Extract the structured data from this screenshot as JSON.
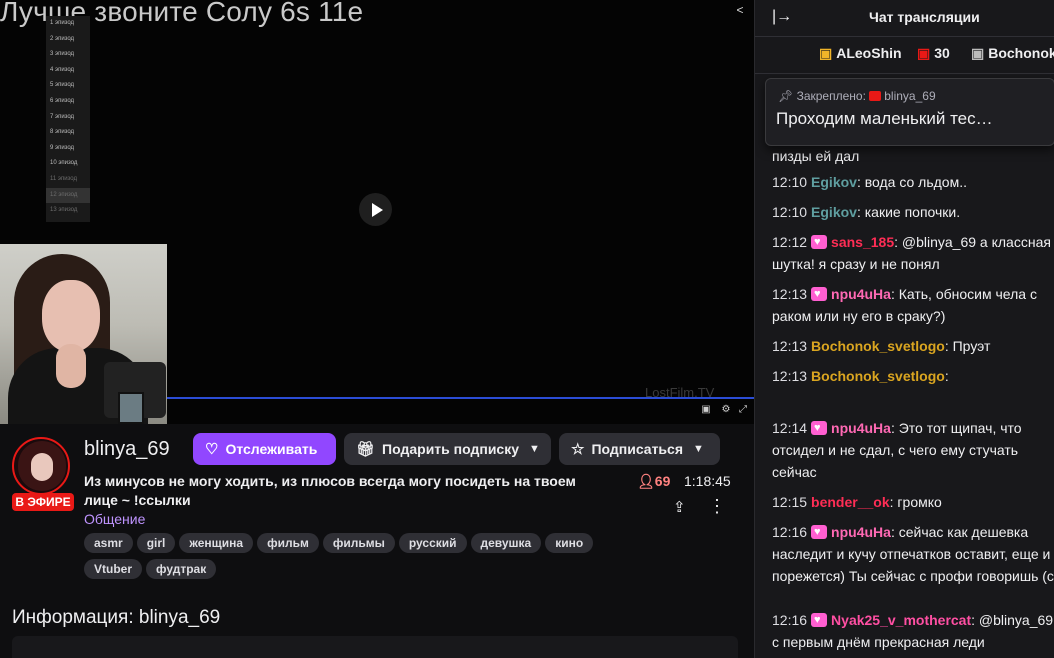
{
  "player": {
    "video_title": "Лучше звоните Солу 6s 11e",
    "episodes": [
      "1 эпизод",
      "2 эпизод",
      "3 эпизод",
      "4 эпизод",
      "5 эпизод",
      "6 эпизод",
      "7 эпизод",
      "8 эпизод",
      "9 эпизод",
      "10 эпизод",
      "11 эпизод",
      "12 эпизод",
      "13 эпизод"
    ],
    "watermark": "LostFilm.TV",
    "share_icon": "share-icon",
    "progress_color": "#2b4dd6"
  },
  "channel": {
    "name": "blinya_69",
    "live_badge": "В ЭФИРЕ",
    "follow_label": "Отслеживать",
    "gift_label": "Подарить подписку",
    "subscribe_label": "Подписаться",
    "stream_title": "Из минусов не могу ходить, из плюсов всегда могу посидеть на твоем лице ~ !ссылки",
    "category": "Общение",
    "viewers": "69",
    "uptime": "1:18:45",
    "tags": [
      "asmr",
      "girl",
      "женщина",
      "фильм",
      "фильмы",
      "русский",
      "девушка",
      "кино",
      "Vtuber",
      "фудтрак"
    ],
    "info_heading": "Информация: blinya_69"
  },
  "colors": {
    "accent": "#9147ff",
    "live": "#e91916",
    "category": "#bf94ff"
  },
  "chat": {
    "title": "Чат трансляции",
    "gifters": [
      {
        "name": "ALeoShin"
      },
      {
        "name": "30"
      },
      {
        "name": "Bochonok"
      }
    ],
    "pinned": {
      "label": "Закреплено:",
      "user": "blinya_69",
      "text": "Проходим маленький тес…"
    },
    "top_fragment": "пизды ей дал",
    "messages": [
      {
        "time": "12:10",
        "user": "Egikov",
        "color": "#5f9ea0",
        "text": ": вода со льдом.."
      },
      {
        "time": "12:10",
        "user": "Egikov",
        "color": "#5f9ea0",
        "text": ": какие попочки."
      },
      {
        "time": "12:12",
        "user": "sans_185",
        "color": "#ff2d55",
        "text": ": @blinya_69 а классная шутка! я сразу и не понял"
      },
      {
        "time": "12:13",
        "user": "npu4uHa",
        "color": "#ff69b4",
        "text": ": Кать, обносим чела с раком или ну его в сраку?)"
      },
      {
        "time": "12:13",
        "user": "Bochonok_svetlogo",
        "color": "#daa520",
        "text": ": Пруэт"
      },
      {
        "time": "12:13",
        "user": "Bochonok_svetlogo",
        "color": "#daa520",
        "text": ":"
      },
      {
        "time": "12:14",
        "user": "npu4uHa",
        "color": "#ff69b4",
        "text": ": Это тот щипач, что отсидел и не сдал, с чего ему стучать сейчас"
      },
      {
        "time": "12:15",
        "user": "bender__ok",
        "color": "#ff2d55",
        "text": ": громко"
      },
      {
        "time": "12:16",
        "user": "npu4uHa",
        "color": "#ff69b4",
        "text": ": сейчас как дешевка наследит и кучу отпечатков оставит, еще и порежется) Ты сейчас с профи говоришь (с)"
      },
      {
        "time": "12:16",
        "user": "Nyak25_v_mothercat",
        "color": "#ff4fa3",
        "text": ": @blinya_69 с первым днём прекрасная леди"
      }
    ]
  }
}
